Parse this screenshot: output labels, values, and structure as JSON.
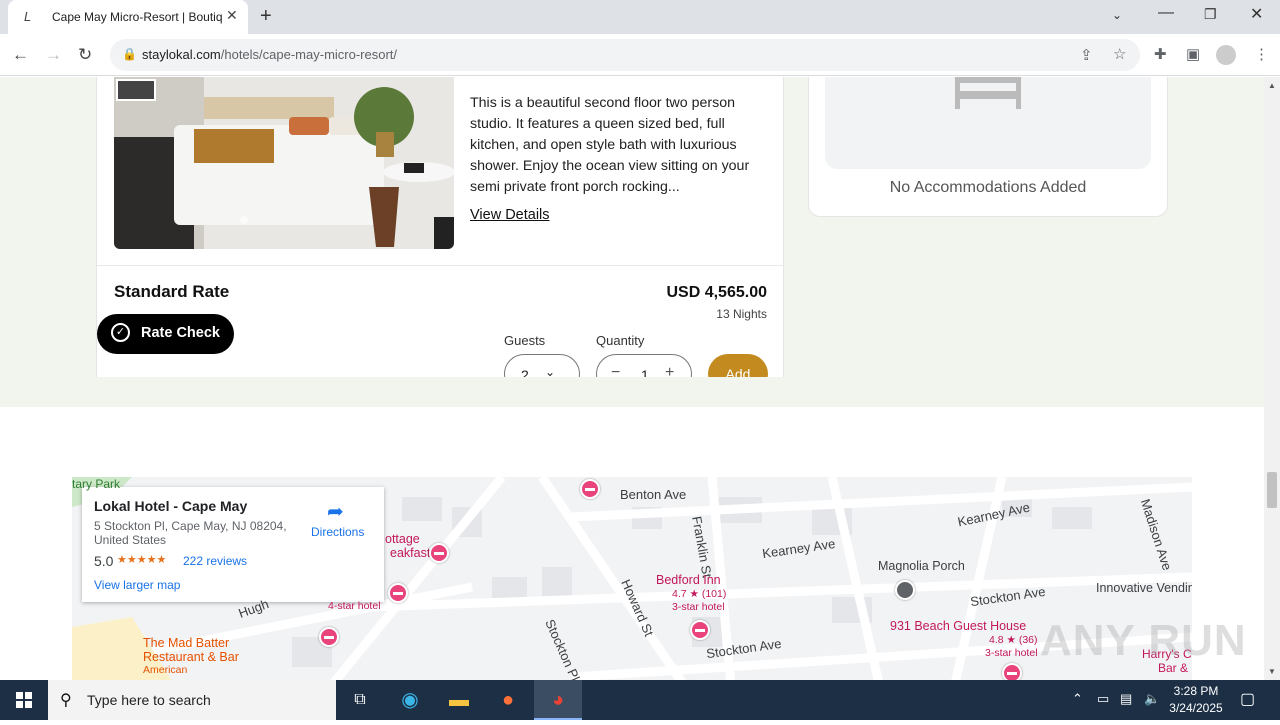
{
  "browser": {
    "tab_title": "Cape May Micro-Resort | Boutiq",
    "tab_favicon": "L",
    "url_host": "staylokal.com",
    "url_path": "/hotels/cape-may-micro-resort/"
  },
  "room": {
    "description": "This is a beautiful second floor two person studio. It features a queen sized bed, full kitchen, and open style bath with luxurious shower. Enjoy the ocean view sitting on your semi private front porch rocking...",
    "view_details": "View Details"
  },
  "rate": {
    "name": "Standard Rate",
    "price": "USD 4,565.00",
    "nights": "13 Nights",
    "rate_check_label": "Rate Check",
    "guests_label": "Guests",
    "guests_value": "2",
    "quantity_label": "Quantity",
    "quantity_value": "1",
    "add_label": "Add"
  },
  "sidebar": {
    "no_accommodations": "No Accommodations Added"
  },
  "map": {
    "place_name": "Lokal Hotel - Cape May",
    "address": "5 Stockton Pl, Cape May, NJ 08204, United States",
    "rating": "5.0",
    "stars": "★★★★★",
    "reviews": "222 reviews",
    "larger_map": "View larger map",
    "directions": "Directions",
    "labels": {
      "benton_ave": "Benton Ave",
      "franklin_st": "Franklin St",
      "kearney_ave_1": "Kearney Ave",
      "kearney_ave_2": "Kearney Ave",
      "madison_ave": "Madison Ave",
      "magnolia_porch": "Magnolia Porch",
      "bedford_inn": "Bedford Inn",
      "bedford_rating": "4.7 ★ (101)",
      "bedford_class": "3-star hotel",
      "howard_st": "Howard St",
      "stockton_pl": "Stockton Pl",
      "stockton_ave_1": "Stockton Ave",
      "stockton_ave_2": "Stockton Ave",
      "beach_guest_house": "931 Beach Guest House",
      "beach_rating": "4.8 ★ (36)",
      "beach_class": "3-star hotel",
      "innovative_vending": "Innovative Vending Solutic",
      "harrys": "Harry's C",
      "harrys_2": "Bar &",
      "cottage": "ottage",
      "breakfast": "eakfast",
      "four_star": "4-star hotel",
      "mad_batter": "The Mad Batter",
      "mad_batter_2": "Restaurant & Bar",
      "mad_batter_type": "American",
      "hugh": "Hugh",
      "tary_park": "tary Park"
    }
  },
  "taskbar": {
    "search_placeholder": "Type here to search",
    "time": "3:28 PM",
    "date": "3/24/2025"
  },
  "watermark": "ANY RUN"
}
